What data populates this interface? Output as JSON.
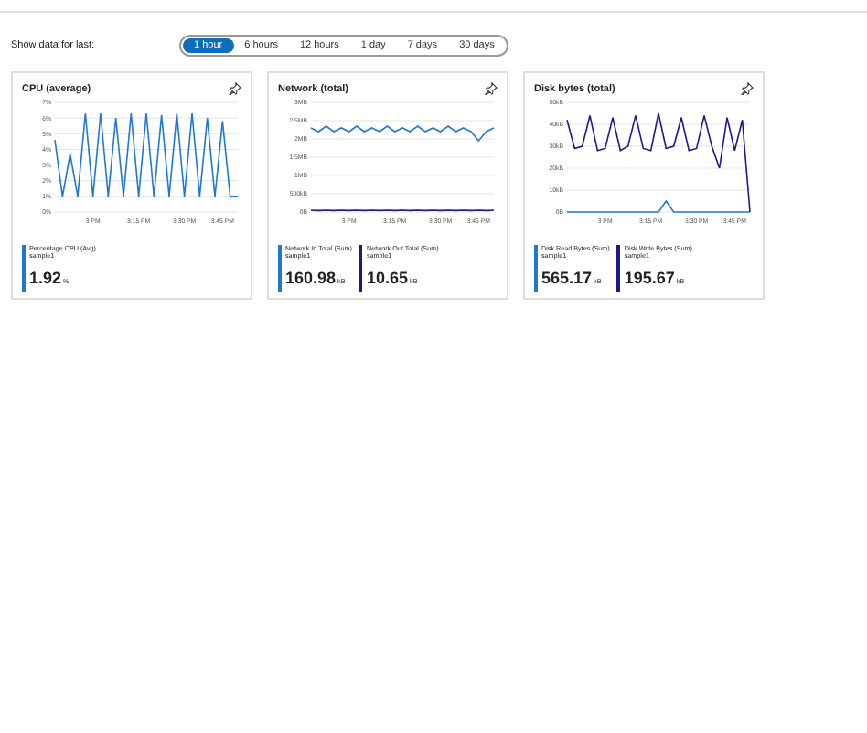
{
  "filter": {
    "label": "Show data for last:",
    "options": [
      {
        "label": "1 hour",
        "selected": true
      },
      {
        "label": "6 hours",
        "selected": false
      },
      {
        "label": "12 hours",
        "selected": false
      },
      {
        "label": "1 day",
        "selected": false
      },
      {
        "label": "7 days",
        "selected": false
      },
      {
        "label": "30 days",
        "selected": false
      }
    ]
  },
  "cards": [
    {
      "title": "CPU (average)",
      "legend": [
        {
          "sub": "sample1",
          "value": "1.92",
          "unit": "%"
        }
      ],
      "chart_data": {
        "type": "line",
        "grid": true,
        "categories": [
          null,
          null,
          null,
          null,
          null,
          "3 PM",
          null,
          null,
          null,
          null,
          null,
          "3:15 PM",
          null,
          null,
          null,
          null,
          null,
          "3:30 PM",
          null,
          null,
          null,
          null,
          "3:45 PM",
          null,
          null
        ],
        "ylim": [
          0,
          7
        ],
        "yticks": [
          {
            "value": 0,
            "label": "0%"
          },
          {
            "value": 1,
            "label": "1%"
          },
          {
            "value": 2,
            "label": "2%"
          },
          {
            "value": 3,
            "label": "3%"
          },
          {
            "value": 4,
            "label": "4%"
          },
          {
            "value": 5,
            "label": "5%"
          },
          {
            "value": 6,
            "label": "6%"
          },
          {
            "value": 7,
            "label": "7%"
          }
        ],
        "series": [
          {
            "name": "Percentage CPU (Avg)",
            "color": "#1f78d1",
            "values": [
              4.6,
              1,
              3.7,
              1,
              6.3,
              1,
              6.3,
              1,
              6,
              1,
              6.3,
              1,
              6.3,
              1,
              6.2,
              1,
              6.3,
              1,
              6.3,
              1,
              6,
              1,
              5.8,
              1,
              1
            ]
          }
        ]
      }
    },
    {
      "title": "Network (total)",
      "legend": [
        {
          "sub": "sample1",
          "value": "160.98",
          "unit": "kB"
        },
        {
          "sub": "sample1",
          "value": "10.65",
          "unit": "kB"
        }
      ],
      "extra_ytick": "500kB",
      "chart_data": {
        "type": "line",
        "grid": true,
        "categories": [
          null,
          null,
          null,
          null,
          null,
          "3 PM",
          null,
          null,
          null,
          null,
          null,
          "3:15 PM",
          null,
          null,
          null,
          null,
          null,
          "3:30 PM",
          null,
          null,
          null,
          null,
          "3:45 PM",
          null,
          null
        ],
        "ylim": [
          0,
          3
        ],
        "yticks": [
          {
            "value": 0,
            "label": "0B"
          },
          {
            "value": 1,
            "label": "1MB"
          },
          {
            "value": 1.5,
            "label": "1.5MB"
          },
          {
            "value": 2,
            "label": "2MB"
          },
          {
            "value": 2.5,
            "label": "2.5MB"
          },
          {
            "value": 3,
            "label": "3MB"
          }
        ],
        "series": [
          {
            "name": "Network In Total (Sum)",
            "color": "#1f78d1",
            "values": [
              2.3,
              2.2,
              2.35,
              2.2,
              2.3,
              2.2,
              2.35,
              2.2,
              2.3,
              2.2,
              2.35,
              2.2,
              2.3,
              2.2,
              2.35,
              2.2,
              2.3,
              2.2,
              2.35,
              2.2,
              2.3,
              2.2,
              1.95,
              2.2,
              2.3
            ]
          },
          {
            "name": "Network Out Total (Sum)",
            "color": "#1a1a8c",
            "values": [
              0.05,
              0.04,
              0.05,
              0.04,
              0.05,
              0.04,
              0.05,
              0.04,
              0.05,
              0.04,
              0.05,
              0.04,
              0.05,
              0.04,
              0.05,
              0.04,
              0.05,
              0.04,
              0.05,
              0.04,
              0.05,
              0.04,
              0.05,
              0.04,
              0.05
            ]
          }
        ]
      }
    },
    {
      "title": "Disk bytes (total)",
      "legend": [
        {
          "sub": "sample1",
          "value": "565.17",
          "unit": "kB"
        },
        {
          "sub": "sample1",
          "value": "195.67",
          "unit": "kB"
        }
      ],
      "chart_data": {
        "type": "line",
        "grid": true,
        "categories": [
          null,
          null,
          null,
          null,
          null,
          "3 PM",
          null,
          null,
          null,
          null,
          null,
          "3:15 PM",
          null,
          null,
          null,
          null,
          null,
          "3:30 PM",
          null,
          null,
          null,
          null,
          "3:45 PM",
          null,
          null
        ],
        "ylim": [
          0,
          50
        ],
        "yticks": [
          {
            "value": 0,
            "label": "0B"
          },
          {
            "value": 10,
            "label": "10kB"
          },
          {
            "value": 20,
            "label": "20kB"
          },
          {
            "value": 30,
            "label": "30kB"
          },
          {
            "value": 40,
            "label": "40kB"
          },
          {
            "value": 50,
            "label": "50kB"
          }
        ],
        "series": [
          {
            "name": "Disk Read Bytes (Sum)",
            "color": "#1f78d1",
            "values": [
              0,
              0,
              0,
              0,
              0,
              0,
              0,
              0,
              0,
              0,
              0,
              0,
              0,
              5,
              0,
              0,
              0,
              0,
              0,
              0,
              0,
              0,
              0,
              0,
              0
            ]
          },
          {
            "name": "Disk Write Bytes (Sum)",
            "color": "#1a1a8c",
            "values": [
              42,
              29,
              30,
              44,
              28,
              29,
              43,
              28,
              30,
              44,
              29,
              28,
              45,
              29,
              30,
              43,
              28,
              29,
              44,
              30,
              20,
              43,
              28,
              42,
              0
            ]
          }
        ]
      }
    }
  ]
}
